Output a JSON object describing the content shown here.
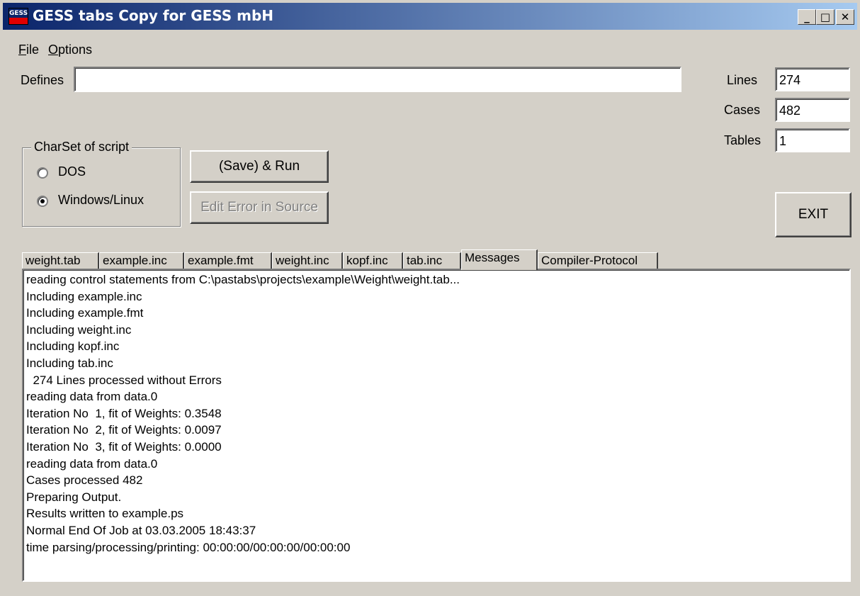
{
  "window": {
    "title": "GESS tabs  Copy for GESS mbH",
    "icon_text": "GESS",
    "controls": {
      "minimize": "_",
      "maximize": "□",
      "close": "✕"
    }
  },
  "menu": {
    "file": {
      "label": "File",
      "underline": "F",
      "rest": "ile"
    },
    "options": {
      "label": "Options",
      "underline": "O",
      "rest": "ptions"
    }
  },
  "defines": {
    "label": "Defines",
    "value": ""
  },
  "stats": {
    "lines_label": "Lines",
    "lines_value": "274",
    "cases_label": "Cases",
    "cases_value": "482",
    "tables_label": "Tables",
    "tables_value": "1"
  },
  "charset": {
    "group_label": "CharSet of script",
    "options": [
      {
        "label": "DOS",
        "selected": false
      },
      {
        "label": "Windows/Linux",
        "selected": true
      }
    ]
  },
  "buttons": {
    "save_run": "(Save)  & Run",
    "edit_error": "Edit Error in Source",
    "exit": "EXIT"
  },
  "tabs": [
    {
      "label": "weight.tab",
      "active": false
    },
    {
      "label": "example.inc",
      "active": false
    },
    {
      "label": "example.fmt",
      "active": false
    },
    {
      "label": "weight.inc",
      "active": false
    },
    {
      "label": "kopf.inc",
      "active": false
    },
    {
      "label": "tab.inc",
      "active": false
    },
    {
      "label": "Messages",
      "active": true
    },
    {
      "label": "Compiler-Protocol",
      "active": false
    }
  ],
  "messages": [
    "reading control statements from C:\\pastabs\\projects\\example\\Weight\\weight.tab...",
    "Including example.inc",
    "Including example.fmt",
    "Including weight.inc",
    "Including kopf.inc",
    "Including tab.inc",
    "  274 Lines processed without Errors",
    "reading data from data.0",
    "Iteration No  1, fit of Weights: 0.3548",
    "Iteration No  2, fit of Weights: 0.0097",
    "Iteration No  3, fit of Weights: 0.0000",
    "reading data from data.0",
    "Cases processed 482",
    "Preparing Output.",
    "Results written to example.ps",
    "Normal End Of Job at 03.03.2005 18:43:37",
    "time parsing/processing/printing: 00:00:00/00:00:00/00:00:00"
  ]
}
